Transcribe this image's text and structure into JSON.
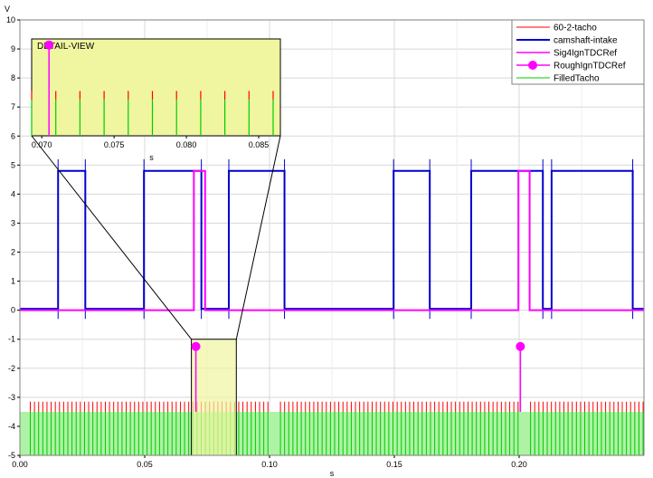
{
  "chart_data": {
    "type": "line",
    "ylabel": "V",
    "xlabel": "s",
    "xlim": [
      0,
      0.25
    ],
    "ylim": [
      -5,
      10
    ],
    "yticks": [
      -5,
      -4,
      -3,
      -2,
      -1,
      0,
      1,
      2,
      3,
      4,
      5,
      6,
      7,
      8,
      9,
      10
    ],
    "xticks": [
      0.0,
      0.05,
      0.1,
      0.15,
      0.2
    ],
    "xtick_labels": [
      "0.00",
      "0.05",
      "0.10",
      "0.15",
      "0.20"
    ],
    "grid": true,
    "legend_position": "top-right",
    "colors": {
      "tacho": "#ff0000",
      "camshaft": "#0000cc",
      "sig4": "#ff00ff",
      "rough": "#ff00ff",
      "filled": "#00cc00",
      "zoom_fill": "#f0f5a0"
    },
    "series": [
      {
        "name": "60-2-tacho",
        "style": "impulse",
        "base": -3.5,
        "height": 0.35,
        "period": 0.00167,
        "gaps": [
          0.0,
          0.1,
          0.2
        ]
      },
      {
        "name": "camshaft-intake",
        "style": "step",
        "low": 0.05,
        "high": 4.8,
        "high_intervals": [
          [
            0.0153,
            0.0262
          ],
          [
            0.0497,
            0.0727
          ],
          [
            0.0837,
            0.106
          ],
          [
            0.1497,
            0.1642
          ],
          [
            0.1808,
            0.2095
          ],
          [
            0.213,
            0.2455
          ]
        ]
      },
      {
        "name": "Sig4IgnTDCRef",
        "style": "step",
        "low": 0.0,
        "high": 4.8,
        "high_intervals": [
          [
            0.0697,
            0.0742
          ],
          [
            0.1997,
            0.2042
          ]
        ]
      },
      {
        "name": "RoughIgnTDCRef",
        "style": "stem",
        "base": -3.5,
        "points": [
          {
            "x": 0.0705,
            "y": -1.25
          },
          {
            "x": 0.2005,
            "y": -1.25
          }
        ]
      },
      {
        "name": "FilledTacho",
        "style": "filled-impulse",
        "base": -5,
        "top": -3.5
      }
    ],
    "zoom_region": {
      "xlim": [
        0.0687,
        0.0867
      ],
      "ylim": [
        -5,
        -1
      ]
    },
    "detail_view": {
      "title": "DETAIL-VIEW",
      "xlabel": "s",
      "xlim": [
        0.0693,
        0.0865
      ],
      "xticks": [
        0.07,
        0.075,
        0.08,
        0.085
      ],
      "xtick_labels": [
        "0.070",
        "0.075",
        "0.080",
        "0.085"
      ],
      "ylim": [
        -5,
        -1
      ],
      "rough_points": [
        {
          "x": 0.0705,
          "y": -1.25
        }
      ]
    }
  }
}
